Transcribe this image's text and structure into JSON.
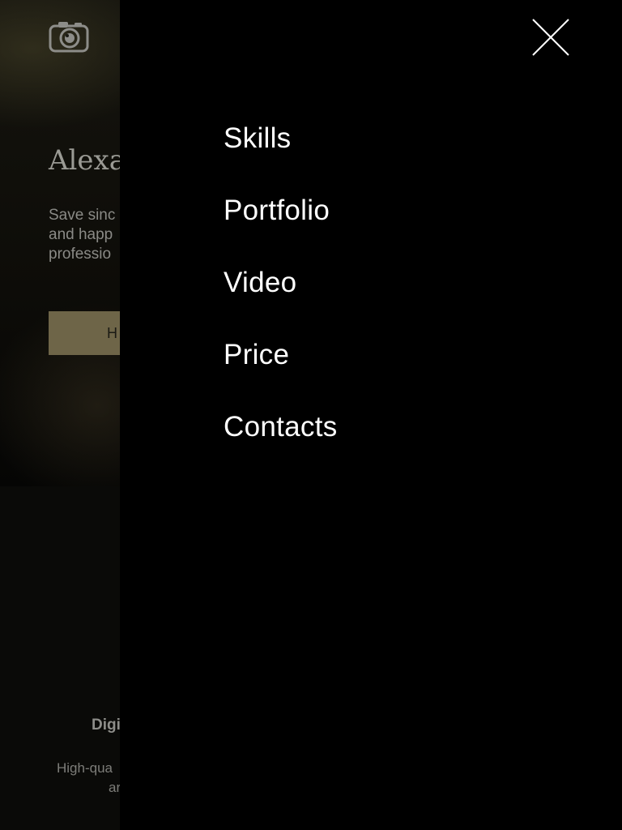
{
  "background_page": {
    "logo_icon": "camera-icon",
    "title": "Alexa",
    "description_lines": [
      "Save sinc",
      "and happ",
      "professio"
    ],
    "cta_label": "H",
    "card_title": "Digi",
    "card_desc_lines": [
      "High-qua",
      "ar"
    ]
  },
  "menu": {
    "close_icon": "close-icon",
    "items": [
      {
        "label": "Skills"
      },
      {
        "label": "Portfolio"
      },
      {
        "label": "Video"
      },
      {
        "label": "Price"
      },
      {
        "label": "Contacts"
      }
    ]
  },
  "colors": {
    "overlay": "#000000",
    "menu_text": "#ffffff",
    "cta_background": "#6e6548"
  }
}
